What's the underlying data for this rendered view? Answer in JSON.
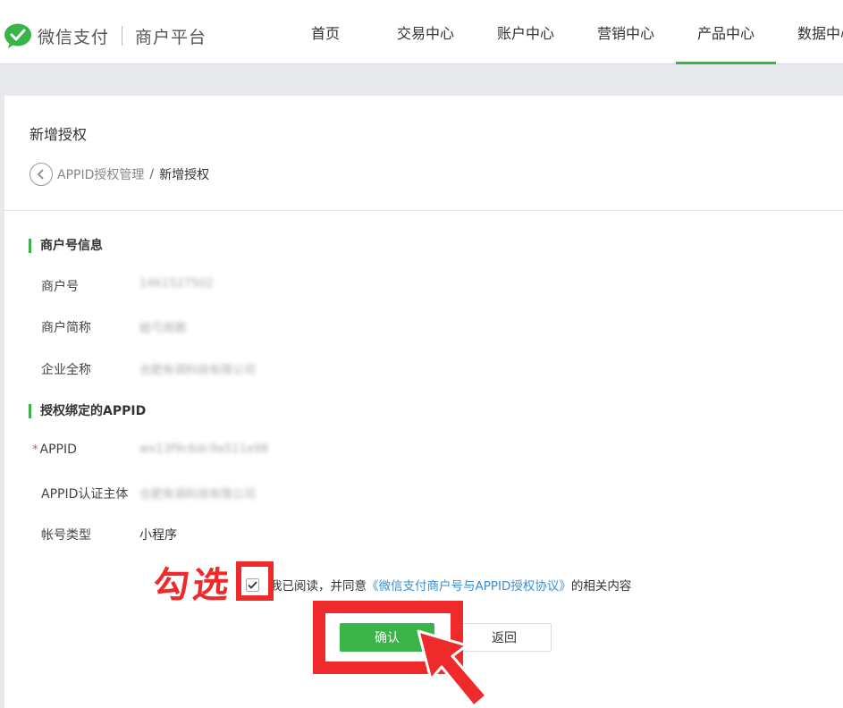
{
  "header": {
    "brand": "微信支付",
    "platform": "商户平台",
    "nav": [
      {
        "label": "首页",
        "active": false
      },
      {
        "label": "交易中心",
        "active": false
      },
      {
        "label": "账户中心",
        "active": false
      },
      {
        "label": "营销中心",
        "active": false
      },
      {
        "label": "产品中心",
        "active": true
      },
      {
        "label": "数据中心",
        "active": false
      }
    ]
  },
  "page": {
    "title": "新增授权",
    "breadcrumb": {
      "parent": "APPID授权管理",
      "separator": "/",
      "current": "新增授权"
    }
  },
  "merchant_section": {
    "title": "商户号信息",
    "rows": [
      {
        "label": "商户号",
        "value": "1461527502"
      },
      {
        "label": "商户简称",
        "value": "蛙弓商圈"
      },
      {
        "label": "企业全称",
        "value": "合肥有调科技有限公司"
      }
    ]
  },
  "appid_section": {
    "title": "授权绑定的APPID",
    "rows": [
      {
        "label": "APPID",
        "value": "wx13f9c6dc9a511e98",
        "required": true,
        "required_mark": "*"
      },
      {
        "label": "APPID认证主体",
        "value": "合肥有调科技有限公司"
      },
      {
        "label": "帐号类型",
        "value": "小程序"
      }
    ]
  },
  "agreement": {
    "checked": true,
    "prefix": "我已阅读，并同意",
    "link": "《微信支付商户号与APPID授权协议》",
    "suffix": "的相关内容"
  },
  "buttons": {
    "confirm": "确认",
    "back": "返回"
  },
  "annotation": {
    "text": "勾选",
    "color": "#ee2a2a"
  },
  "colors": {
    "accent": "#3ab449",
    "link": "#3b8fd6",
    "required": "#e24d4d"
  },
  "icons": {
    "logo": "wechat-pay-logo-icon",
    "back": "chevron-left-icon",
    "check": "checkmark-icon",
    "arrow": "pointer-arrow-icon"
  }
}
